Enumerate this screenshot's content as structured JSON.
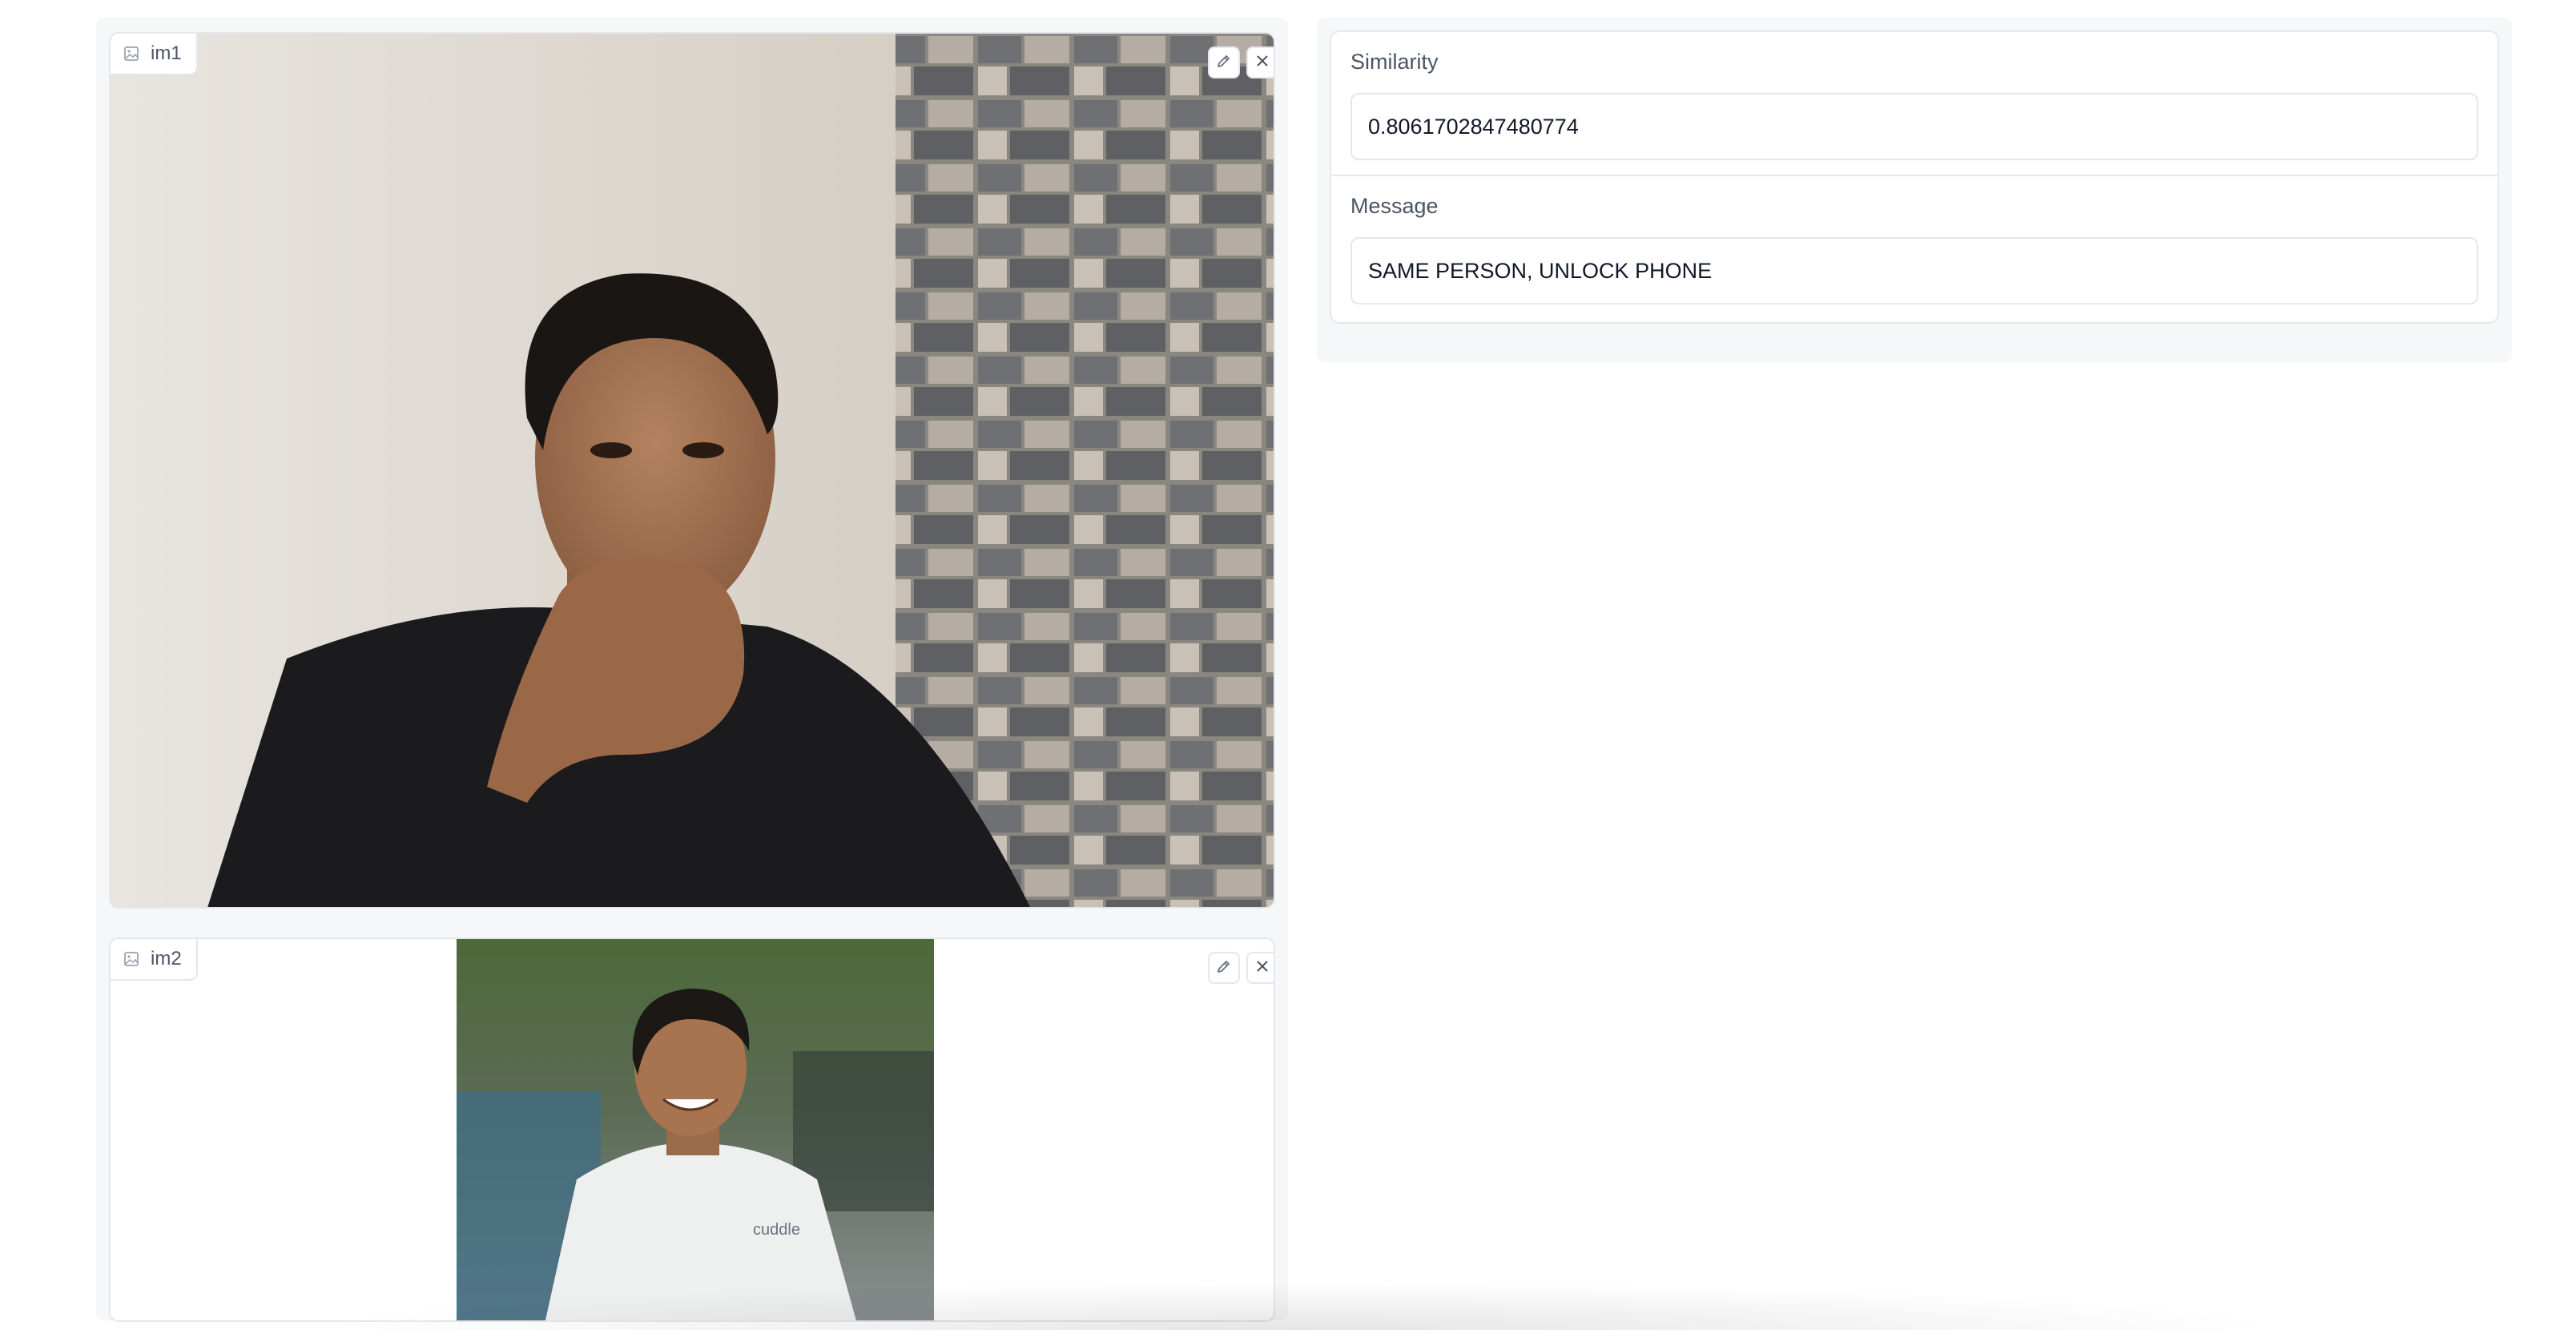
{
  "inputs": {
    "im1": {
      "label": "im1",
      "icon": "image-icon",
      "edit_icon": "pencil-icon",
      "clear_icon": "close-icon"
    },
    "im2": {
      "label": "im2",
      "icon": "image-icon",
      "edit_icon": "pencil-icon",
      "clear_icon": "close-icon",
      "shirt_logo_text": "cuddle"
    }
  },
  "outputs": {
    "similarity": {
      "label": "Similarity",
      "value": "0.8061702847480774"
    },
    "message": {
      "label": "Message",
      "value": "SAME PERSON, UNLOCK PHONE"
    }
  },
  "colors": {
    "panel_bg": "#f6f7f9",
    "border": "#e5e7eb",
    "label_text": "#4b5563",
    "value_text": "#111827"
  }
}
